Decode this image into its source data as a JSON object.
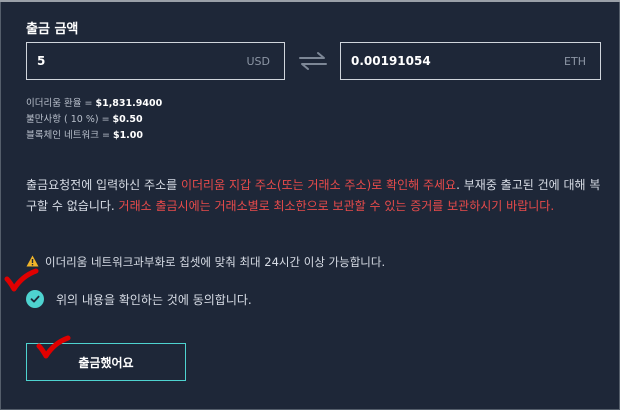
{
  "title": "출금 금액",
  "amount_input": {
    "value": "5",
    "unit": "USD"
  },
  "converted_input": {
    "value": "0.00191054",
    "unit": "ETH"
  },
  "rates": [
    {
      "label": "이더리움 환율 = ",
      "value": "$1,831.9400"
    },
    {
      "label": "불만사항 ( 10 %) =  ",
      "value": "$0.50"
    },
    {
      "label": "블록체인 네트워크 = ",
      "value": "$1.00"
    }
  ],
  "notice": {
    "part1": "출금요청전에 입력하신 주소를 ",
    "part2_red": "이더리움 지갑 주소(또는 거래소 주소)로 확인해 주세요",
    "part3": ". 부재중 출고된 건에 대해 복구할 수 없습니다. ",
    "part4_red": "거래소 출금시에는 거래소별로 최소한으로 보관할 수 있는 증거를 보관하시기 바랍니다."
  },
  "warning_text": "이더리움 네트워크과부화로 칩셋에 맞춰 최대 24시간 이상 가능합니다.",
  "agree_label": "위의 내용을 확인하는 것에 동의합니다.",
  "agree_checked": true,
  "submit_label": "출금했어요",
  "colors": {
    "accent": "#4ed3d0",
    "alert": "#e84b4b",
    "background": "#1e2738",
    "annotation": "#e00000"
  },
  "icons": [
    "swap-arrows-icon",
    "warning-icon",
    "checkmark-icon",
    "red-check-annotation-icon"
  ]
}
